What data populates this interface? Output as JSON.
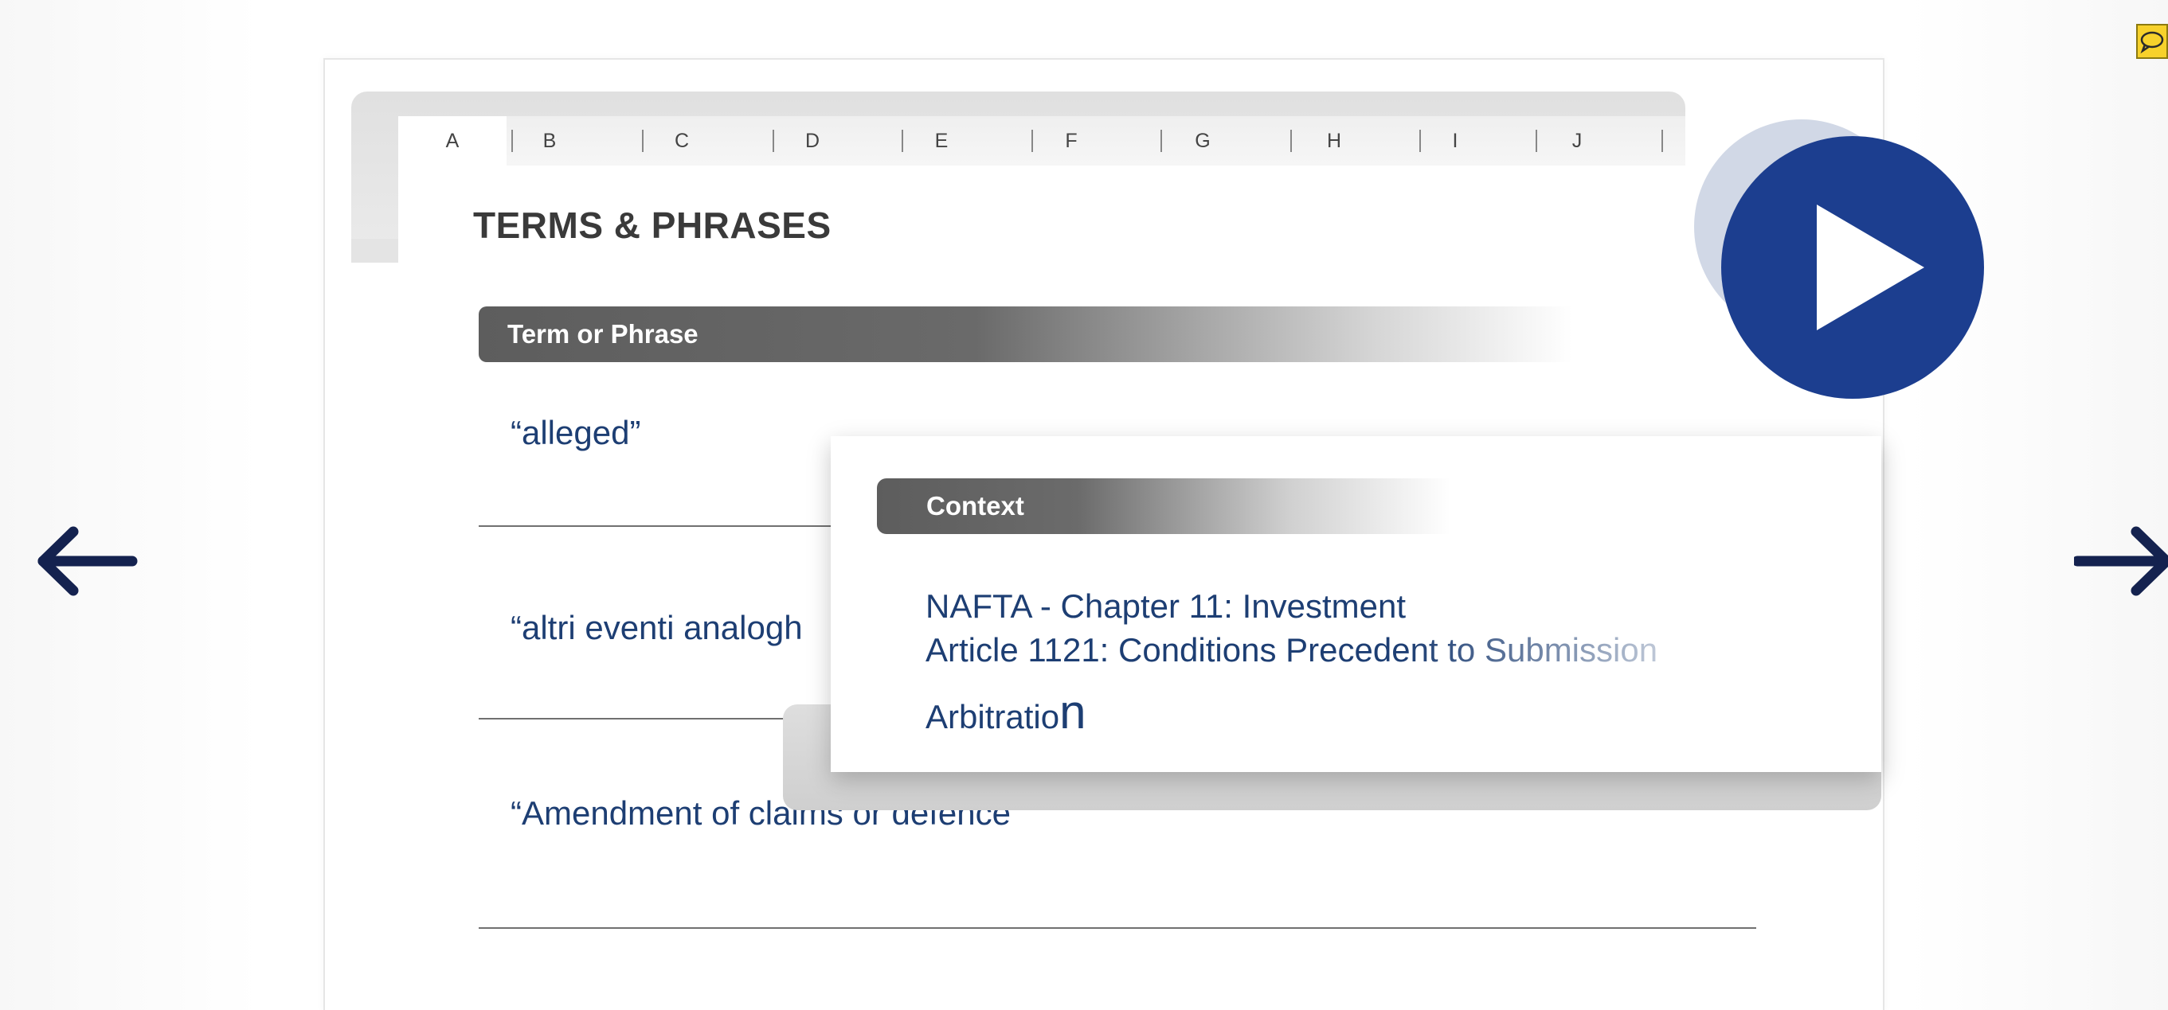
{
  "letter_tabs": [
    "A",
    "B",
    "C",
    "D",
    "E",
    "F",
    "G",
    "H",
    "I",
    "J"
  ],
  "active_letter": "A",
  "title": "TERMS & PHRASES",
  "term_header": "Term or Phrase",
  "terms": [
    "“alleged”",
    "“altri eventi analogh",
    "“Amendment of claims or defence”"
  ],
  "context_popup": {
    "header": "Context",
    "line1": "NAFTA - Chapter 11: Investment",
    "line2": "Article 1121: Conditions Precedent to Submission",
    "line3_main": "Arbitratio",
    "line3_last": "n"
  },
  "icons": {
    "prev": "arrow-left-icon",
    "next": "arrow-right-icon",
    "play": "play-icon",
    "comment": "comment-icon"
  },
  "colors": {
    "accent": "#1c3e8f",
    "text_link": "#1d3e73",
    "arrow": "#14224f",
    "header_grey": "#5d5d5d"
  }
}
